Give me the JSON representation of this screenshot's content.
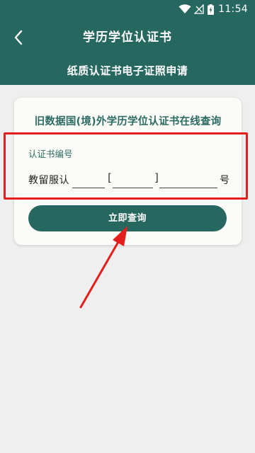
{
  "status_bar": {
    "time": "11:54",
    "icons": [
      "wifi-icon",
      "signal-icon",
      "battery-charging-icon"
    ]
  },
  "app_bar": {
    "back_icon": "chevron-left-icon",
    "title": "学历学位认证书"
  },
  "sub_bar": {
    "title": "纸质认证书电子证照申请"
  },
  "card": {
    "title": "旧数据国(境)外学历学位认证书在线查询",
    "cert_label": "认证书编号",
    "cert_prefix": "教留服认",
    "bracket_open": "[",
    "bracket_close": "]",
    "cert_suffix": "号",
    "query_button": "立即查询"
  },
  "annotation": {
    "highlight_color": "#e41d1d",
    "arrow_color": "#e41d1d"
  },
  "colors": {
    "brand": "#26675f",
    "page_background": "#efefef",
    "card_background": "#fbfcf7"
  }
}
